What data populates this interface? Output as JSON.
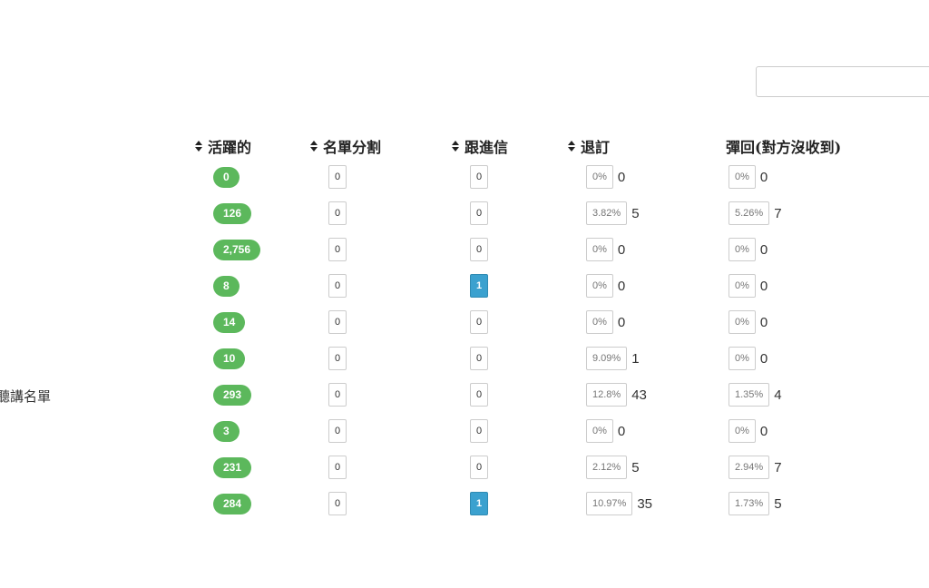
{
  "headers": {
    "active": "活躍的",
    "split": "名單分割",
    "followup": "跟進信",
    "unsubscribe": "退訂",
    "bounce": "彈回(對方沒收到)"
  },
  "rows": [
    {
      "name": "",
      "active": "0",
      "split": "0",
      "followup": "0",
      "unsub_pct": "0%",
      "unsub_count": "0",
      "bounce_pct": "0%",
      "bounce_count": "0"
    },
    {
      "name": "",
      "active": "126",
      "split": "0",
      "followup": "0",
      "unsub_pct": "3.82%",
      "unsub_count": "5",
      "bounce_pct": "5.26%",
      "bounce_count": "7"
    },
    {
      "name": "",
      "active": "2,756",
      "split": "0",
      "followup": "0",
      "unsub_pct": "0%",
      "unsub_count": "0",
      "bounce_pct": "0%",
      "bounce_count": "0"
    },
    {
      "name": "",
      "active": "8",
      "split": "0",
      "followup": "1",
      "unsub_pct": "0%",
      "unsub_count": "0",
      "bounce_pct": "0%",
      "bounce_count": "0"
    },
    {
      "name": "",
      "active": "14",
      "split": "0",
      "followup": "0",
      "unsub_pct": "0%",
      "unsub_count": "0",
      "bounce_pct": "0%",
      "bounce_count": "0"
    },
    {
      "name": "",
      "active": "10",
      "split": "0",
      "followup": "0",
      "unsub_pct": "9.09%",
      "unsub_count": "1",
      "bounce_pct": "0%",
      "bounce_count": "0"
    },
    {
      "name": "聽講名單",
      "active": "293",
      "split": "0",
      "followup": "0",
      "unsub_pct": "12.8%",
      "unsub_count": "43",
      "bounce_pct": "1.35%",
      "bounce_count": "4"
    },
    {
      "name": "",
      "active": "3",
      "split": "0",
      "followup": "0",
      "unsub_pct": "0%",
      "unsub_count": "0",
      "bounce_pct": "0%",
      "bounce_count": "0"
    },
    {
      "name": "",
      "active": "231",
      "split": "0",
      "followup": "0",
      "unsub_pct": "2.12%",
      "unsub_count": "5",
      "bounce_pct": "2.94%",
      "bounce_count": "7"
    },
    {
      "name": "",
      "active": "284",
      "split": "0",
      "followup": "1",
      "unsub_pct": "10.97%",
      "unsub_count": "35",
      "bounce_pct": "1.73%",
      "bounce_count": "5"
    }
  ],
  "colors": {
    "active_badge": "#5cb85c",
    "followup_highlight": "#3ba1cf"
  }
}
